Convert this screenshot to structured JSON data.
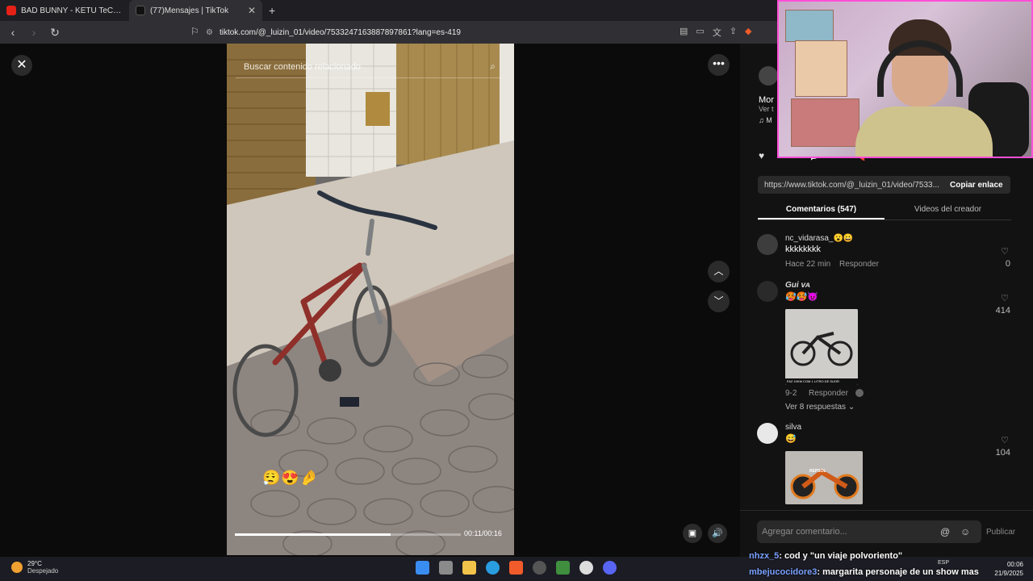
{
  "browser": {
    "tabs": [
      {
        "title": "BAD BUNNY - KETU TeCRÉ (Video Of",
        "active": false
      },
      {
        "title": "(77)Mensajes | TikTok",
        "active": true
      }
    ],
    "url": "tiktok.com/@_luizin_01/video/7533247163887897861?lang=es-419"
  },
  "video": {
    "search_placeholder": "Buscar contenido relacionado",
    "time": "00:11/00:16",
    "progress_fraction": 0.6875,
    "emojis": "😮‍💨😍🤌"
  },
  "panel": {
    "user_partial": "Mor",
    "user_sub_partial": "Ver t",
    "music_partial": "♫ M",
    "link": "https://www.tiktok.com/@_luizin_01/video/7533...",
    "copy_label": "Copiar enlace",
    "tabs": [
      {
        "label": "Comentarios (547)",
        "active": true
      },
      {
        "label": "Videos del creador",
        "active": false
      }
    ],
    "comments": [
      {
        "user": "nc_vidarasa_😮😀",
        "text": "kkkkkkkk",
        "meta": "Hace 22 min",
        "reply": "Responder",
        "likes": "0"
      },
      {
        "user": "Gui ᴠᴀ",
        "text": "🥵🥵😈",
        "meta": "9-2",
        "reply": "Responder",
        "likes": "414",
        "replies_label": "Ver 8 respuestas ⌄",
        "image_caption": "FAZ 10KM COM 1 LITRO DE SUOR"
      },
      {
        "user": "silva",
        "text": "😅",
        "likes": "104",
        "image_label": "REPSOL"
      }
    ],
    "comment_placeholder": "Agregar comentario...",
    "publish_label": "Publicar"
  },
  "chat": [
    {
      "user": "nhzx_5",
      "message": ": cod y \"un viaje polvoriento\""
    },
    {
      "user": "mbejucocidore3",
      "message": ": margarita personaje de un show mas"
    }
  ],
  "taskbar": {
    "temp": "29°C",
    "weather": "Despejado",
    "lang": "ESP",
    "time": "00:06",
    "date": "21/9/2025"
  }
}
